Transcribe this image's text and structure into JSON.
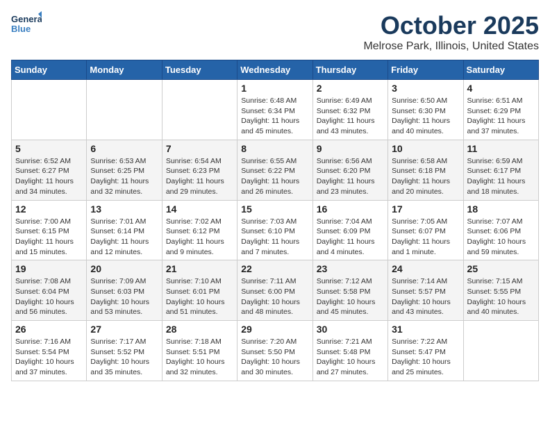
{
  "header": {
    "logo_line1": "General",
    "logo_line2": "Blue",
    "month": "October 2025",
    "location": "Melrose Park, Illinois, United States"
  },
  "days_of_week": [
    "Sunday",
    "Monday",
    "Tuesday",
    "Wednesday",
    "Thursday",
    "Friday",
    "Saturday"
  ],
  "weeks": [
    [
      {
        "day": "",
        "empty": true
      },
      {
        "day": "",
        "empty": true
      },
      {
        "day": "",
        "empty": true
      },
      {
        "day": "1",
        "sunrise": "6:48 AM",
        "sunset": "6:34 PM",
        "daylight": "11 hours and 45 minutes."
      },
      {
        "day": "2",
        "sunrise": "6:49 AM",
        "sunset": "6:32 PM",
        "daylight": "11 hours and 43 minutes."
      },
      {
        "day": "3",
        "sunrise": "6:50 AM",
        "sunset": "6:30 PM",
        "daylight": "11 hours and 40 minutes."
      },
      {
        "day": "4",
        "sunrise": "6:51 AM",
        "sunset": "6:29 PM",
        "daylight": "11 hours and 37 minutes."
      }
    ],
    [
      {
        "day": "5",
        "sunrise": "6:52 AM",
        "sunset": "6:27 PM",
        "daylight": "11 hours and 34 minutes."
      },
      {
        "day": "6",
        "sunrise": "6:53 AM",
        "sunset": "6:25 PM",
        "daylight": "11 hours and 32 minutes."
      },
      {
        "day": "7",
        "sunrise": "6:54 AM",
        "sunset": "6:23 PM",
        "daylight": "11 hours and 29 minutes."
      },
      {
        "day": "8",
        "sunrise": "6:55 AM",
        "sunset": "6:22 PM",
        "daylight": "11 hours and 26 minutes."
      },
      {
        "day": "9",
        "sunrise": "6:56 AM",
        "sunset": "6:20 PM",
        "daylight": "11 hours and 23 minutes."
      },
      {
        "day": "10",
        "sunrise": "6:58 AM",
        "sunset": "6:18 PM",
        "daylight": "11 hours and 20 minutes."
      },
      {
        "day": "11",
        "sunrise": "6:59 AM",
        "sunset": "6:17 PM",
        "daylight": "11 hours and 18 minutes."
      }
    ],
    [
      {
        "day": "12",
        "sunrise": "7:00 AM",
        "sunset": "6:15 PM",
        "daylight": "11 hours and 15 minutes."
      },
      {
        "day": "13",
        "sunrise": "7:01 AM",
        "sunset": "6:14 PM",
        "daylight": "11 hours and 12 minutes."
      },
      {
        "day": "14",
        "sunrise": "7:02 AM",
        "sunset": "6:12 PM",
        "daylight": "11 hours and 9 minutes."
      },
      {
        "day": "15",
        "sunrise": "7:03 AM",
        "sunset": "6:10 PM",
        "daylight": "11 hours and 7 minutes."
      },
      {
        "day": "16",
        "sunrise": "7:04 AM",
        "sunset": "6:09 PM",
        "daylight": "11 hours and 4 minutes."
      },
      {
        "day": "17",
        "sunrise": "7:05 AM",
        "sunset": "6:07 PM",
        "daylight": "11 hours and 1 minute."
      },
      {
        "day": "18",
        "sunrise": "7:07 AM",
        "sunset": "6:06 PM",
        "daylight": "10 hours and 59 minutes."
      }
    ],
    [
      {
        "day": "19",
        "sunrise": "7:08 AM",
        "sunset": "6:04 PM",
        "daylight": "10 hours and 56 minutes."
      },
      {
        "day": "20",
        "sunrise": "7:09 AM",
        "sunset": "6:03 PM",
        "daylight": "10 hours and 53 minutes."
      },
      {
        "day": "21",
        "sunrise": "7:10 AM",
        "sunset": "6:01 PM",
        "daylight": "10 hours and 51 minutes."
      },
      {
        "day": "22",
        "sunrise": "7:11 AM",
        "sunset": "6:00 PM",
        "daylight": "10 hours and 48 minutes."
      },
      {
        "day": "23",
        "sunrise": "7:12 AM",
        "sunset": "5:58 PM",
        "daylight": "10 hours and 45 minutes."
      },
      {
        "day": "24",
        "sunrise": "7:14 AM",
        "sunset": "5:57 PM",
        "daylight": "10 hours and 43 minutes."
      },
      {
        "day": "25",
        "sunrise": "7:15 AM",
        "sunset": "5:55 PM",
        "daylight": "10 hours and 40 minutes."
      }
    ],
    [
      {
        "day": "26",
        "sunrise": "7:16 AM",
        "sunset": "5:54 PM",
        "daylight": "10 hours and 37 minutes."
      },
      {
        "day": "27",
        "sunrise": "7:17 AM",
        "sunset": "5:52 PM",
        "daylight": "10 hours and 35 minutes."
      },
      {
        "day": "28",
        "sunrise": "7:18 AM",
        "sunset": "5:51 PM",
        "daylight": "10 hours and 32 minutes."
      },
      {
        "day": "29",
        "sunrise": "7:20 AM",
        "sunset": "5:50 PM",
        "daylight": "10 hours and 30 minutes."
      },
      {
        "day": "30",
        "sunrise": "7:21 AM",
        "sunset": "5:48 PM",
        "daylight": "10 hours and 27 minutes."
      },
      {
        "day": "31",
        "sunrise": "7:22 AM",
        "sunset": "5:47 PM",
        "daylight": "10 hours and 25 minutes."
      },
      {
        "day": "",
        "empty": true
      }
    ]
  ],
  "labels": {
    "sunrise_prefix": "Sunrise: ",
    "sunset_prefix": "Sunset: ",
    "daylight_prefix": "Daylight: "
  }
}
